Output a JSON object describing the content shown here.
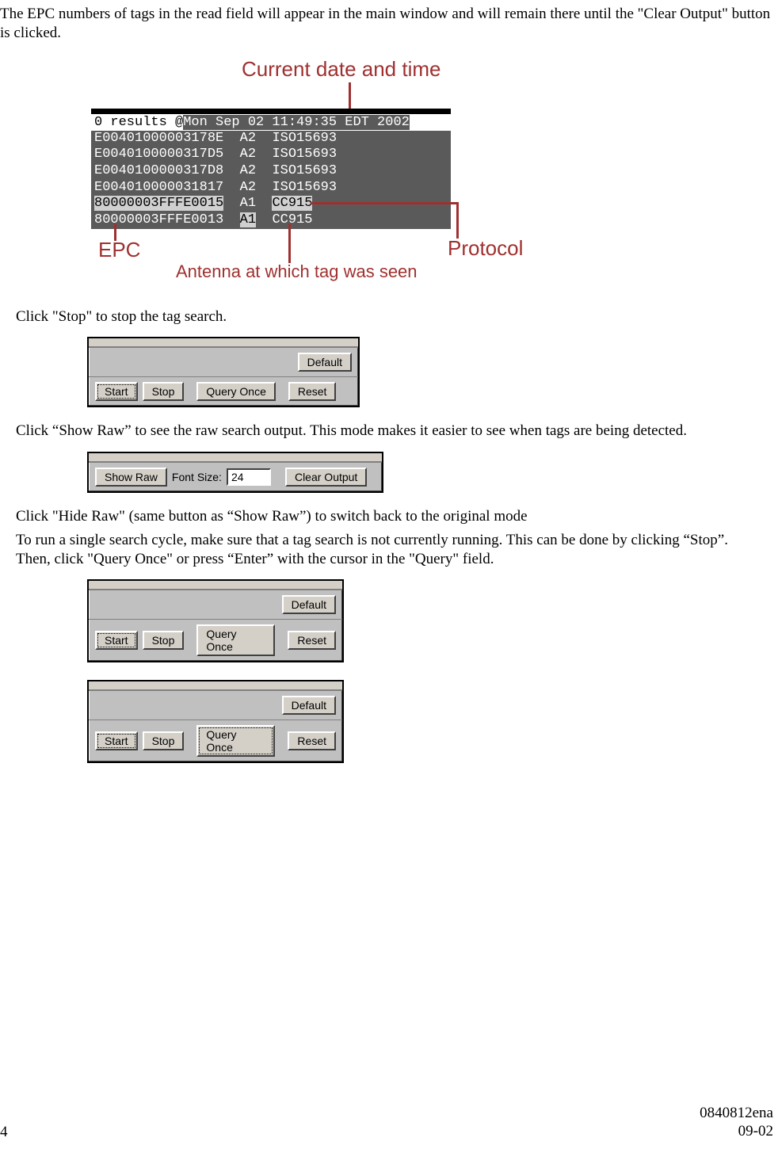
{
  "intro_paragraph": "The EPC numbers of tags in the read field will appear in the main window and will remain there until the \"Clear Output\" button is clicked.",
  "fig1": {
    "label_top": "Current date and time",
    "label_epc": "EPC",
    "label_protocol": "Protocol",
    "label_antenna": "Antenna at which tag was seen",
    "header_prefix": "0 results @",
    "header_date": "Mon Sep 02 11:49:35 EDT 2002",
    "rows": [
      {
        "epc": "E00401000003178E",
        "ant": "A2",
        "proto": "ISO15693"
      },
      {
        "epc": "E0040100000317D5",
        "ant": "A2",
        "proto": "ISO15693"
      },
      {
        "epc": "E0040100000317D8",
        "ant": "A2",
        "proto": "ISO15693"
      },
      {
        "epc": "E004010000031817",
        "ant": "A2",
        "proto": "ISO15693"
      },
      {
        "epc": "80000003FFFE0015",
        "ant": "A1",
        "proto": "CC915"
      },
      {
        "epc": "80000003FFFE0013",
        "ant": "A1",
        "proto": "CC915"
      }
    ]
  },
  "para_stop": "Click \"Stop\" to stop the tag search.",
  "panel_stop": {
    "default": "Default",
    "start": "Start",
    "stop": "Stop",
    "query_once": "Query Once",
    "reset": "Reset"
  },
  "para_show_raw": "Click “Show Raw” to see the raw search output. This mode makes it easier to see when tags are being detected.",
  "panel_showraw": {
    "show_raw": "Show Raw",
    "font_size_label": "Font Size:",
    "font_size_value": "24",
    "clear_output": "Clear Output"
  },
  "para_hide_raw": "Click \"Hide Raw\" (same button as “Show Raw”) to switch back to the original mode",
  "para_query_once": "To run a single search cycle, make sure that a tag search is not currently running. This can be done by clicking “Stop”. Then, click \"Query Once\" or press “Enter” with the cursor in the \"Query\" field.",
  "footer": {
    "page": "4",
    "docnum": "0840812ena",
    "date": "09-02"
  }
}
